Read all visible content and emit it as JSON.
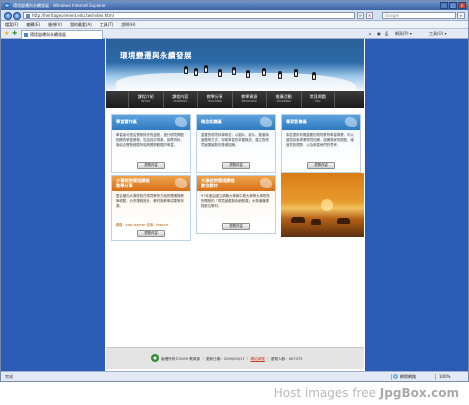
{
  "window": {
    "title": "環境變遷與永續發展 - Windows Internet Explorer"
  },
  "address": {
    "url": "http://heritagecement.edu.tw/index.html",
    "search_placeholder": "Google"
  },
  "menu": [
    "檔案(F)",
    "編輯(E)",
    "檢視(V)",
    "我的最愛(A)",
    "工具(T)",
    "說明(H)"
  ],
  "tab": {
    "label": "環境變遷與永續發展"
  },
  "commands": {
    "page": "網頁(P) ▾",
    "tools": "工具(O) ▾"
  },
  "site": {
    "banner_title": "環境變遷與永續發展",
    "nav": [
      {
        "label": "課程介紹",
        "en": "INTRO"
      },
      {
        "label": "課程內容",
        "en": "LEARNING"
      },
      {
        "label": "教學分享",
        "en": "TEACHING"
      },
      {
        "label": "教學資源",
        "en": "RESOURCE"
      },
      {
        "label": "推廣活動",
        "en": "LEARNING"
      },
      {
        "label": "常見問題",
        "en": "FAQ"
      }
    ],
    "cards": [
      {
        "title": "學習實作區",
        "body": "學習者可經由實際操作的過程，進行環境問題相關的學習歷程，包括探討現象、設釋資料、與結合實務經驗所能夠實際體驗的學習。",
        "button": "瀏覽內容"
      },
      {
        "title": "概念知識區",
        "body": "重要的環境科學概念，以圖片、影片、動畫與遊戲等方式，幫助學習的掌握概念、建立對環境變遷議題的基礎認識。",
        "button": "瀏覽內容"
      },
      {
        "title": "專家影像區",
        "body": "本區提供有關重要的環境教育學習專業，可以讓您探索專業環境知識，認識專家的觀點，增進您的視野，以及學習他們的思考。",
        "button": "瀏覽內容"
      },
      {
        "title": "大專校院環境課程",
        "title2": "教學分享",
        "body": "整合國內大專院校在環境教育方面的開課與教學經驗，分享課程設計、教材與教學成果等資源。",
        "links": [
          "網路：post-teacher",
          "影像：teacher"
        ],
        "button": "瀏覽內容"
      },
      {
        "title": "大專校院環境課程",
        "title2": "數位教材",
        "body": "97年度由國立師範大學與中原大學等大專院校所開發的「環境變遷與永續發展」大專通識課程數位教材。",
        "button": "瀏覽內容"
      }
    ],
    "footer": {
      "copyright": "版權所有©2009 教育部",
      "updated": "更新日期：2009/03/17",
      "link": "網站導覽",
      "visitors": "瀏覽人數：007375"
    }
  },
  "status": {
    "text": "完成",
    "zone": "網際網路",
    "zoom": "100%"
  },
  "watermark": {
    "prefix": "Host images free ",
    "brand": "JpgBox.com"
  }
}
